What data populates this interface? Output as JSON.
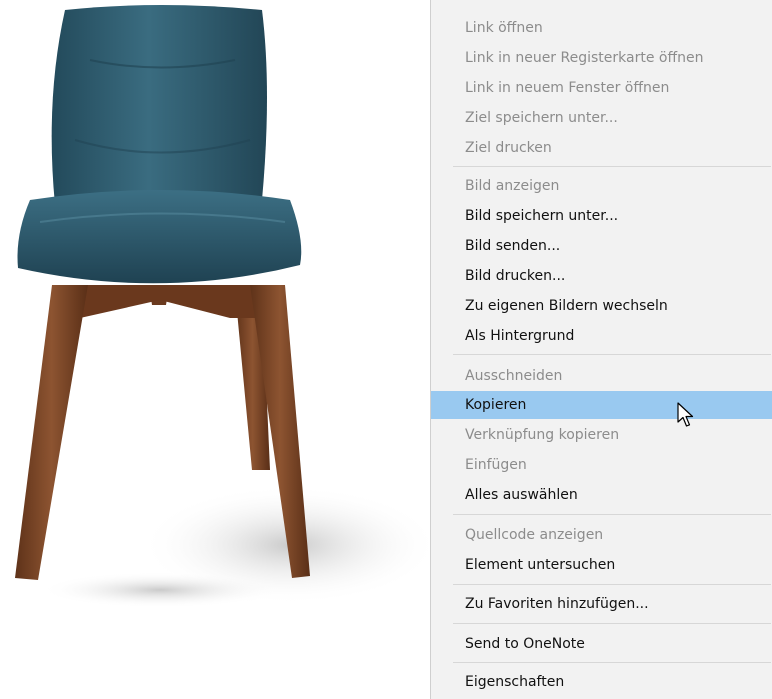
{
  "context_menu": {
    "items": [
      {
        "label": "Link öffnen"
      },
      {
        "label": "Link in neuer Registerkarte öffnen"
      },
      {
        "label": "Link in neuem Fenster öffnen"
      },
      {
        "label": "Ziel speichern unter..."
      },
      {
        "label": "Ziel drucken"
      },
      {
        "label": "Bild anzeigen"
      },
      {
        "label": "Bild speichern unter..."
      },
      {
        "label": "Bild senden..."
      },
      {
        "label": "Bild drucken..."
      },
      {
        "label": "Zu eigenen Bildern wechseln"
      },
      {
        "label": "Als Hintergrund"
      },
      {
        "label": "Ausschneiden"
      },
      {
        "label": "Kopieren"
      },
      {
        "label": "Verknüpfung kopieren"
      },
      {
        "label": "Einfügen"
      },
      {
        "label": "Alles auswählen"
      },
      {
        "label": "Quellcode anzeigen"
      },
      {
        "label": "Element untersuchen"
      },
      {
        "label": "Zu Favoriten hinzufügen..."
      },
      {
        "label": "Send to OneNote"
      },
      {
        "label": "Eigenschaften"
      }
    ],
    "highlighted_item": "Kopieren"
  },
  "colors": {
    "menu_background": "#f2f2f2",
    "highlight": "#99c9f0",
    "disabled_text": "#8c8c8c",
    "enabled_text": "#111111",
    "chair_upholstery": "#2f5b6e",
    "chair_wood": "#7a4527"
  },
  "icons": {
    "cursor": "mouse-pointer-icon"
  }
}
